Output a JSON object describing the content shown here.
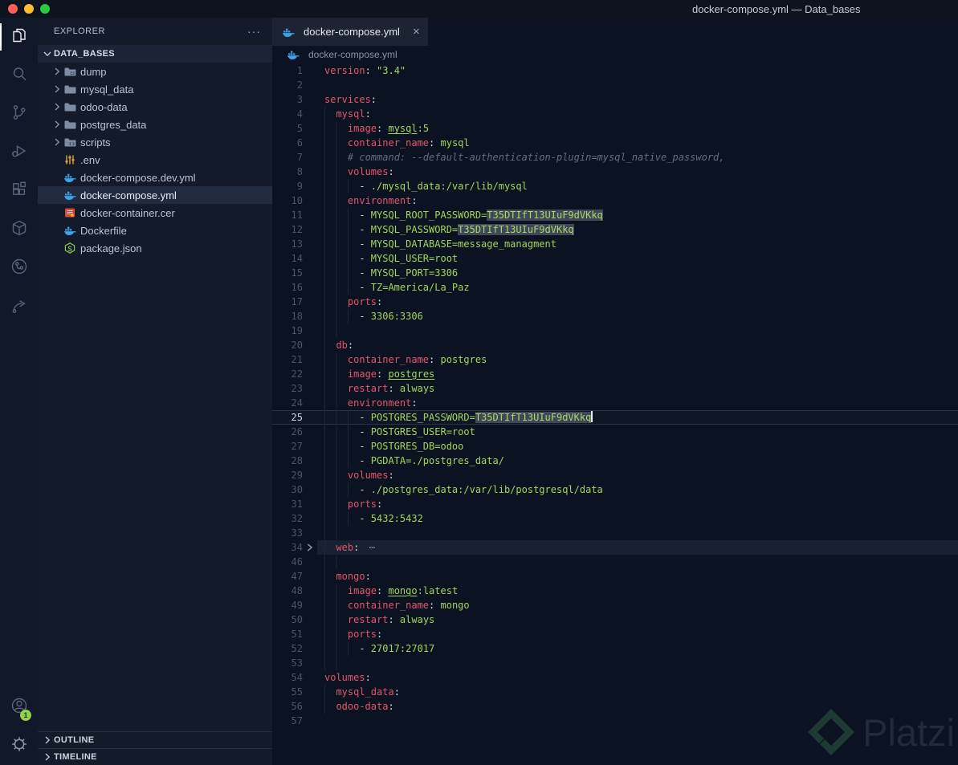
{
  "title_bar": {
    "title": "docker-compose.yml — Data_bases"
  },
  "activity_bar": {
    "items": [
      {
        "name": "explorer",
        "icon": "files-icon",
        "active": true
      },
      {
        "name": "search",
        "icon": "search-icon"
      },
      {
        "name": "source-control",
        "icon": "source-control-icon"
      },
      {
        "name": "run-debug",
        "icon": "debug-icon"
      },
      {
        "name": "extensions",
        "icon": "extensions-icon"
      },
      {
        "name": "docker-extension",
        "icon": "package-box-icon"
      },
      {
        "name": "gitlens",
        "icon": "circle-branch-icon"
      },
      {
        "name": "live-share",
        "icon": "share-arrow-icon"
      }
    ],
    "account_badge": "1"
  },
  "sidebar": {
    "header": "EXPLORER",
    "more_glyph": "···",
    "root": "DATA_BASES",
    "items": [
      {
        "label": "dump",
        "icon": "folder-dump-icon",
        "kind": "folder"
      },
      {
        "label": "mysql_data",
        "icon": "folder-icon",
        "kind": "folder"
      },
      {
        "label": "odoo-data",
        "icon": "folder-icon",
        "kind": "folder"
      },
      {
        "label": "postgres_data",
        "icon": "folder-icon",
        "kind": "folder"
      },
      {
        "label": "scripts",
        "icon": "folder-scripts-icon",
        "kind": "folder"
      },
      {
        "label": ".env",
        "icon": "env-icon",
        "kind": "file"
      },
      {
        "label": "docker-compose.dev.yml",
        "icon": "docker-icon",
        "kind": "file"
      },
      {
        "label": "docker-compose.yml",
        "icon": "docker-icon",
        "kind": "file",
        "selected": true
      },
      {
        "label": "docker-container.cer",
        "icon": "certificate-icon",
        "kind": "file"
      },
      {
        "label": "Dockerfile",
        "icon": "docker-icon",
        "kind": "file"
      },
      {
        "label": "package.json",
        "icon": "node-icon",
        "kind": "file"
      }
    ],
    "panels": [
      {
        "label": "OUTLINE"
      },
      {
        "label": "TIMELINE"
      }
    ]
  },
  "editor": {
    "tab": {
      "label": "docker-compose.yml",
      "icon": "docker-icon",
      "close_glyph": "×"
    },
    "breadcrumb": "docker-compose.yml",
    "lines": [
      {
        "n": 1,
        "i": 0,
        "s": [
          [
            "k",
            "version"
          ],
          [
            "p",
            ": "
          ],
          [
            "v",
            "\"3.4\""
          ]
        ]
      },
      {
        "n": 2,
        "i": 0,
        "s": []
      },
      {
        "n": 3,
        "i": 0,
        "s": [
          [
            "k",
            "services"
          ],
          [
            "p",
            ":"
          ]
        ]
      },
      {
        "n": 4,
        "i": 2,
        "s": [
          [
            "k",
            "mysql"
          ],
          [
            "p",
            ":"
          ]
        ]
      },
      {
        "n": 5,
        "i": 4,
        "s": [
          [
            "k",
            "image"
          ],
          [
            "p",
            ": "
          ],
          [
            "l",
            "mysql"
          ],
          [
            "v",
            ":5"
          ]
        ]
      },
      {
        "n": 6,
        "i": 4,
        "s": [
          [
            "k",
            "container_name"
          ],
          [
            "p",
            ": "
          ],
          [
            "v",
            "mysql"
          ]
        ]
      },
      {
        "n": 7,
        "i": 4,
        "s": [
          [
            "c",
            "# command: --default-authentication-plugin=mysql_native_password,"
          ]
        ]
      },
      {
        "n": 8,
        "i": 4,
        "s": [
          [
            "k",
            "volumes"
          ],
          [
            "p",
            ":"
          ]
        ]
      },
      {
        "n": 9,
        "i": 6,
        "s": [
          [
            "p",
            "- "
          ],
          [
            "v",
            "./mysql_data:/var/lib/mysql"
          ]
        ]
      },
      {
        "n": 10,
        "i": 4,
        "s": [
          [
            "k",
            "environment"
          ],
          [
            "p",
            ":"
          ]
        ]
      },
      {
        "n": 11,
        "i": 6,
        "s": [
          [
            "p",
            "- "
          ],
          [
            "v",
            "MYSQL_ROOT_PASSWORD="
          ],
          [
            "h",
            "T35DTIfT13UIuF9dVKkq"
          ]
        ]
      },
      {
        "n": 12,
        "i": 6,
        "s": [
          [
            "p",
            "- "
          ],
          [
            "v",
            "MYSQL_PASSWORD="
          ],
          [
            "h",
            "T35DTIfT13UIuF9dVKkq"
          ]
        ]
      },
      {
        "n": 13,
        "i": 6,
        "s": [
          [
            "p",
            "- "
          ],
          [
            "v",
            "MYSQL_DATABASE=message_managment"
          ]
        ]
      },
      {
        "n": 14,
        "i": 6,
        "s": [
          [
            "p",
            "- "
          ],
          [
            "v",
            "MYSQL_USER=root"
          ]
        ]
      },
      {
        "n": 15,
        "i": 6,
        "s": [
          [
            "p",
            "- "
          ],
          [
            "v",
            "MYSQL_PORT=3306"
          ]
        ]
      },
      {
        "n": 16,
        "i": 6,
        "s": [
          [
            "p",
            "- "
          ],
          [
            "v",
            "TZ=America/La_Paz"
          ]
        ]
      },
      {
        "n": 17,
        "i": 4,
        "s": [
          [
            "k",
            "ports"
          ],
          [
            "p",
            ":"
          ]
        ]
      },
      {
        "n": 18,
        "i": 6,
        "s": [
          [
            "p",
            "- "
          ],
          [
            "v",
            "3306:3306"
          ]
        ]
      },
      {
        "n": 19,
        "i": 4,
        "s": []
      },
      {
        "n": 20,
        "i": 2,
        "s": [
          [
            "k",
            "db"
          ],
          [
            "p",
            ":"
          ]
        ]
      },
      {
        "n": 21,
        "i": 4,
        "s": [
          [
            "k",
            "container_name"
          ],
          [
            "p",
            ": "
          ],
          [
            "v",
            "postgres"
          ]
        ]
      },
      {
        "n": 22,
        "i": 4,
        "s": [
          [
            "k",
            "image"
          ],
          [
            "p",
            ": "
          ],
          [
            "l",
            "postgres"
          ]
        ]
      },
      {
        "n": 23,
        "i": 4,
        "s": [
          [
            "k",
            "restart"
          ],
          [
            "p",
            ": "
          ],
          [
            "v",
            "always"
          ]
        ]
      },
      {
        "n": 24,
        "i": 4,
        "s": [
          [
            "k",
            "environment"
          ],
          [
            "p",
            ":"
          ]
        ]
      },
      {
        "n": 25,
        "i": 6,
        "s": [
          [
            "p",
            "- "
          ],
          [
            "v",
            "POSTGRES_PASSWORD="
          ],
          [
            "h",
            "T35DTIfT13UIuF9dVKkq"
          ]
        ],
        "cur": 1
      },
      {
        "n": 26,
        "i": 6,
        "s": [
          [
            "p",
            "- "
          ],
          [
            "v",
            "POSTGRES_USER=root"
          ]
        ]
      },
      {
        "n": 27,
        "i": 6,
        "s": [
          [
            "p",
            "- "
          ],
          [
            "v",
            "POSTGRES_DB=odoo"
          ]
        ]
      },
      {
        "n": 28,
        "i": 6,
        "s": [
          [
            "p",
            "- "
          ],
          [
            "v",
            "PGDATA=./postgres_data/"
          ]
        ]
      },
      {
        "n": 29,
        "i": 4,
        "s": [
          [
            "k",
            "volumes"
          ],
          [
            "p",
            ":"
          ]
        ]
      },
      {
        "n": 30,
        "i": 6,
        "s": [
          [
            "p",
            "- "
          ],
          [
            "v",
            "./postgres_data:/var/lib/postgresql/data"
          ]
        ]
      },
      {
        "n": 31,
        "i": 4,
        "s": [
          [
            "k",
            "ports"
          ],
          [
            "p",
            ":"
          ]
        ]
      },
      {
        "n": 32,
        "i": 6,
        "s": [
          [
            "p",
            "- "
          ],
          [
            "v",
            "5432:5432"
          ]
        ]
      },
      {
        "n": 33,
        "i": 4,
        "s": []
      },
      {
        "n": 34,
        "i": 2,
        "s": [
          [
            "k",
            "web"
          ],
          [
            "p",
            ": "
          ],
          [
            "f",
            "⋯"
          ]
        ],
        "fold": 1
      },
      {
        "n": 46,
        "i": 4,
        "s": []
      },
      {
        "n": 47,
        "i": 2,
        "s": [
          [
            "k",
            "mongo"
          ],
          [
            "p",
            ":"
          ]
        ]
      },
      {
        "n": 48,
        "i": 4,
        "s": [
          [
            "k",
            "image"
          ],
          [
            "p",
            ": "
          ],
          [
            "l",
            "mongo"
          ],
          [
            "v",
            ":latest"
          ]
        ]
      },
      {
        "n": 49,
        "i": 4,
        "s": [
          [
            "k",
            "container_name"
          ],
          [
            "p",
            ": "
          ],
          [
            "v",
            "mongo"
          ]
        ]
      },
      {
        "n": 50,
        "i": 4,
        "s": [
          [
            "k",
            "restart"
          ],
          [
            "p",
            ": "
          ],
          [
            "v",
            "always"
          ]
        ]
      },
      {
        "n": 51,
        "i": 4,
        "s": [
          [
            "k",
            "ports"
          ],
          [
            "p",
            ":"
          ]
        ]
      },
      {
        "n": 52,
        "i": 6,
        "s": [
          [
            "p",
            "- "
          ],
          [
            "v",
            "27017:27017"
          ]
        ]
      },
      {
        "n": 53,
        "i": 4,
        "s": []
      },
      {
        "n": 54,
        "i": 0,
        "s": [
          [
            "k",
            "volumes"
          ],
          [
            "p",
            ":"
          ]
        ]
      },
      {
        "n": 55,
        "i": 2,
        "s": [
          [
            "k",
            "mysql_data"
          ],
          [
            "p",
            ":"
          ]
        ]
      },
      {
        "n": 56,
        "i": 2,
        "s": [
          [
            "k",
            "odoo-data"
          ],
          [
            "p",
            ":"
          ]
        ]
      },
      {
        "n": 57,
        "i": 0,
        "s": []
      }
    ]
  },
  "watermark": {
    "text": "Platzi"
  },
  "colors": {
    "editor_bg": "#0b1221",
    "sidebar_bg": "#131b2b",
    "key_red": "#e4566b",
    "string_green": "#a3d65c",
    "comment_gray": "#5f6e84",
    "docker_blue": "#3fa3e8",
    "badge_green": "#8fd04b",
    "highlight_box": "#3f4759"
  }
}
